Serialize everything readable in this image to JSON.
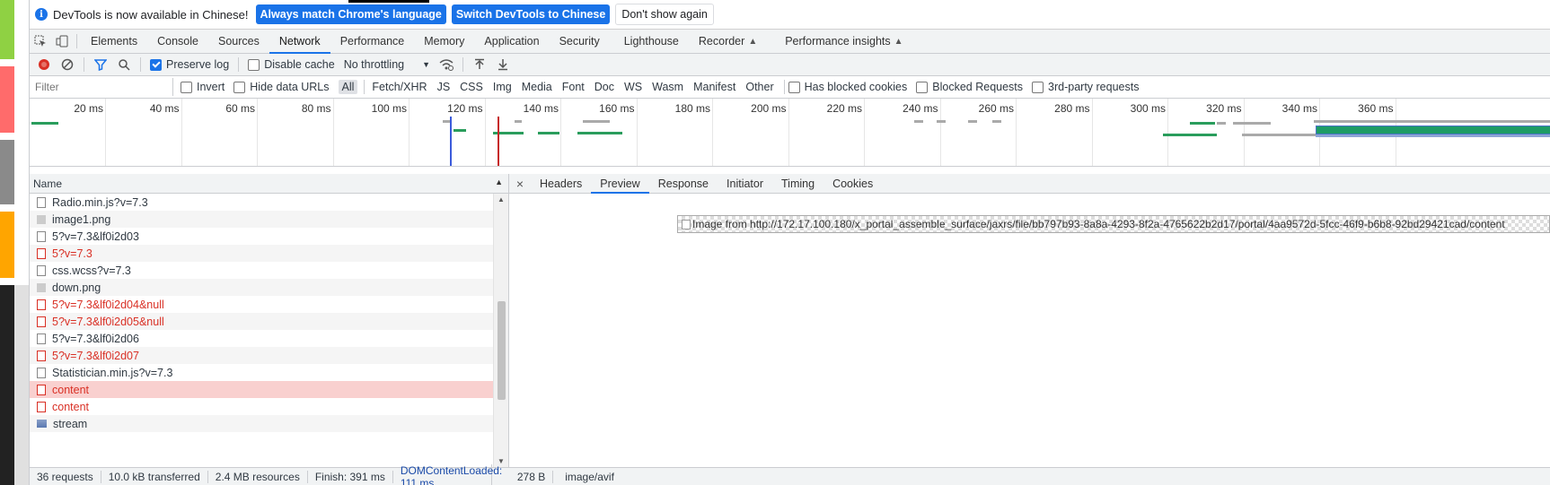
{
  "infobar": {
    "message": "DevTools is now available in Chinese!",
    "btn_match": "Always match Chrome's language",
    "btn_switch": "Switch DevTools to Chinese",
    "btn_dismiss": "Don't show again"
  },
  "tabs": [
    {
      "label": "Elements"
    },
    {
      "label": "Console"
    },
    {
      "label": "Sources"
    },
    {
      "label": "Network"
    },
    {
      "label": "Performance"
    },
    {
      "label": "Memory"
    },
    {
      "label": "Application"
    },
    {
      "label": "Security"
    },
    {
      "label": "Lighthouse"
    },
    {
      "label": "Recorder"
    },
    {
      "label": "Performance insights"
    }
  ],
  "toolbar": {
    "preserve_log": "Preserve log",
    "disable_cache": "Disable cache",
    "throttling": "No throttling"
  },
  "filterbar": {
    "placeholder": "Filter",
    "invert": "Invert",
    "hide_data_urls": "Hide data URLs",
    "types": [
      "All",
      "Fetch/XHR",
      "JS",
      "CSS",
      "Img",
      "Media",
      "Font",
      "Doc",
      "WS",
      "Wasm",
      "Manifest",
      "Other"
    ],
    "has_blocked_cookies": "Has blocked cookies",
    "blocked_requests": "Blocked Requests",
    "third_party": "3rd-party requests"
  },
  "overview": {
    "ticks": [
      "20 ms",
      "40 ms",
      "60 ms",
      "80 ms",
      "100 ms",
      "120 ms",
      "140 ms",
      "160 ms",
      "180 ms",
      "200 ms",
      "220 ms",
      "240 ms",
      "260 ms",
      "280 ms",
      "300 ms",
      "320 ms",
      "340 ms",
      "360 ms"
    ]
  },
  "requests": {
    "column_name": "Name",
    "rows": [
      {
        "name": "Radio.min.js?v=7.3",
        "kind": "file",
        "state": ""
      },
      {
        "name": "image1.png",
        "kind": "img",
        "state": ""
      },
      {
        "name": "5?v=7.3&lf0i2d03",
        "kind": "file",
        "state": ""
      },
      {
        "name": "5?v=7.3",
        "kind": "file",
        "state": "err"
      },
      {
        "name": "css.wcss?v=7.3",
        "kind": "file",
        "state": ""
      },
      {
        "name": "down.png",
        "kind": "img",
        "state": ""
      },
      {
        "name": "5?v=7.3&lf0i2d04&null",
        "kind": "file",
        "state": "err"
      },
      {
        "name": "5?v=7.3&lf0i2d05&null",
        "kind": "file",
        "state": "err"
      },
      {
        "name": "5?v=7.3&lf0i2d06",
        "kind": "file",
        "state": ""
      },
      {
        "name": "5?v=7.3&lf0i2d07",
        "kind": "file",
        "state": "err"
      },
      {
        "name": "Statistician.min.js?v=7.3",
        "kind": "file",
        "state": ""
      },
      {
        "name": "content",
        "kind": "file",
        "state": "err-sel"
      },
      {
        "name": "content",
        "kind": "file",
        "state": "err"
      },
      {
        "name": "stream",
        "kind": "stream",
        "state": ""
      }
    ]
  },
  "detail": {
    "tabs": [
      "Headers",
      "Preview",
      "Response",
      "Initiator",
      "Timing",
      "Cookies"
    ],
    "active_tab": "Preview",
    "preview_alt": "Image from http://172.17.100.180/x_portal_assemble_surface/jaxrs/file/bb797b93-8a8a-4293-8f2a-4765622b2d17/portal/4aa9572d-5fcc-46f9-b6b8-92bd29421cad/content"
  },
  "status": {
    "requests": "36 requests",
    "transferred": "10.0 kB transferred",
    "resources": "2.4 MB resources",
    "finish": "Finish: 391 ms",
    "dcl": "DOMContentLoaded: 111 ms",
    "size": "278 B",
    "mime": "image/avif"
  }
}
